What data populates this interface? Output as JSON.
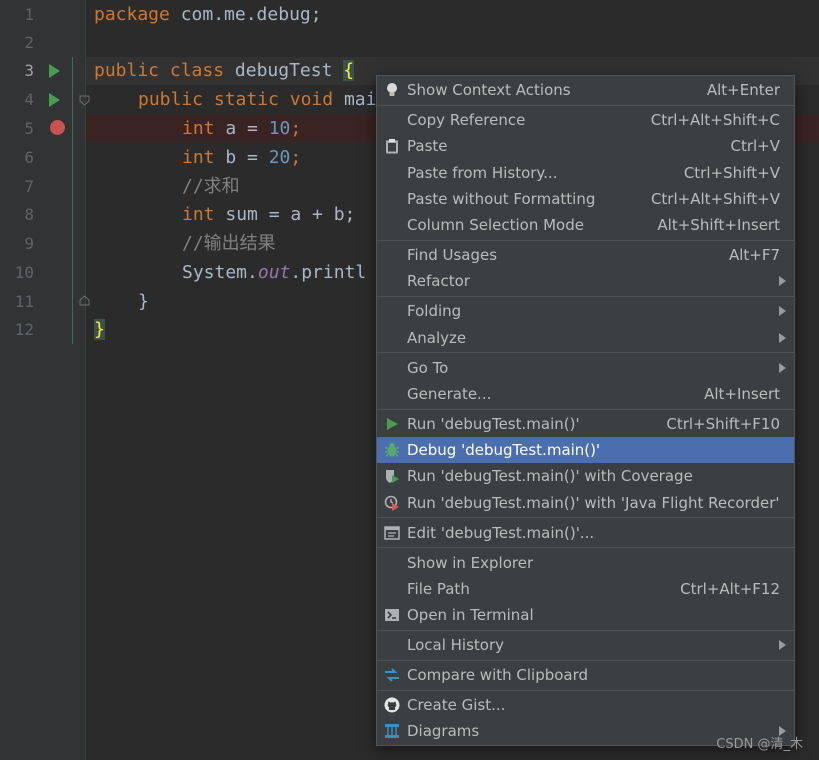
{
  "editor": {
    "line_numbers": [
      "1",
      "2",
      "3",
      "4",
      "5",
      "6",
      "7",
      "8",
      "9",
      "10",
      "11",
      "12"
    ],
    "lines": {
      "l1": {
        "kw": "package",
        "rest": " com.me.debug;"
      },
      "l3": {
        "kw1": "public",
        "kw2": "class",
        "name": " debugTest ",
        "brace": "{"
      },
      "l4": {
        "kw1": "public",
        "kw2": "static",
        "kw3": "void",
        "name": " mai"
      },
      "l5": {
        "type": "int",
        "mid": " a = ",
        "num": "10",
        "end": ";"
      },
      "l6": {
        "type": "int",
        "mid": " b = ",
        "num": "20",
        "end": ";"
      },
      "l7": {
        "comment": "//求和"
      },
      "l8": {
        "type": "int",
        "rest": " sum = a + b;"
      },
      "l9": {
        "comment": "//输出结果"
      },
      "l10": {
        "a": "System.",
        "field": "out",
        "b": ".printl"
      },
      "l11": {
        "brace": "}"
      },
      "l12": {
        "brace": "}"
      }
    }
  },
  "menu": {
    "items": [
      {
        "label": "Show Context Actions",
        "shortcut": "Alt+Enter",
        "icon": "bulb-icon"
      },
      {
        "label": "Copy Reference",
        "shortcut": "Ctrl+Alt+Shift+C"
      },
      {
        "label": "Paste",
        "shortcut": "Ctrl+V",
        "icon": "clipboard-icon"
      },
      {
        "label": "Paste from History...",
        "shortcut": "Ctrl+Shift+V"
      },
      {
        "label": "Paste without Formatting",
        "shortcut": "Ctrl+Alt+Shift+V"
      },
      {
        "label": "Column Selection Mode",
        "shortcut": "Alt+Shift+Insert"
      },
      {
        "label": "Find Usages",
        "shortcut": "Alt+F7"
      },
      {
        "label": "Refactor",
        "submenu": true
      },
      {
        "label": "Folding",
        "submenu": true
      },
      {
        "label": "Analyze",
        "submenu": true
      },
      {
        "label": "Go To",
        "submenu": true
      },
      {
        "label": "Generate...",
        "shortcut": "Alt+Insert"
      },
      {
        "label": "Run 'debugTest.main()'",
        "shortcut": "Ctrl+Shift+F10",
        "icon": "run-icon"
      },
      {
        "label": "Debug 'debugTest.main()'",
        "icon": "bug-icon",
        "selected": true
      },
      {
        "label": "Run 'debugTest.main()' with Coverage",
        "icon": "coverage-icon"
      },
      {
        "label": "Run 'debugTest.main()' with 'Java Flight Recorder'",
        "icon": "profiler-icon"
      },
      {
        "label": "Edit 'debugTest.main()'...",
        "icon": "edit-config-icon"
      },
      {
        "label": "Show in Explorer"
      },
      {
        "label": "File Path",
        "shortcut": "Ctrl+Alt+F12"
      },
      {
        "label": "Open in Terminal",
        "icon": "terminal-icon"
      },
      {
        "label": "Local History",
        "submenu": true
      },
      {
        "label": "Compare with Clipboard",
        "icon": "compare-icon"
      },
      {
        "label": "Create Gist...",
        "icon": "github-icon"
      },
      {
        "label": "Diagrams",
        "icon": "diagram-icon",
        "submenu": true
      }
    ]
  },
  "watermark": "CSDN @清_木",
  "colors": {
    "menu_bg": "#3c3f41",
    "selection": "#4b6eaf",
    "keyword": "#cc7832",
    "number": "#6897bb",
    "breakpoint": "#c75450"
  }
}
